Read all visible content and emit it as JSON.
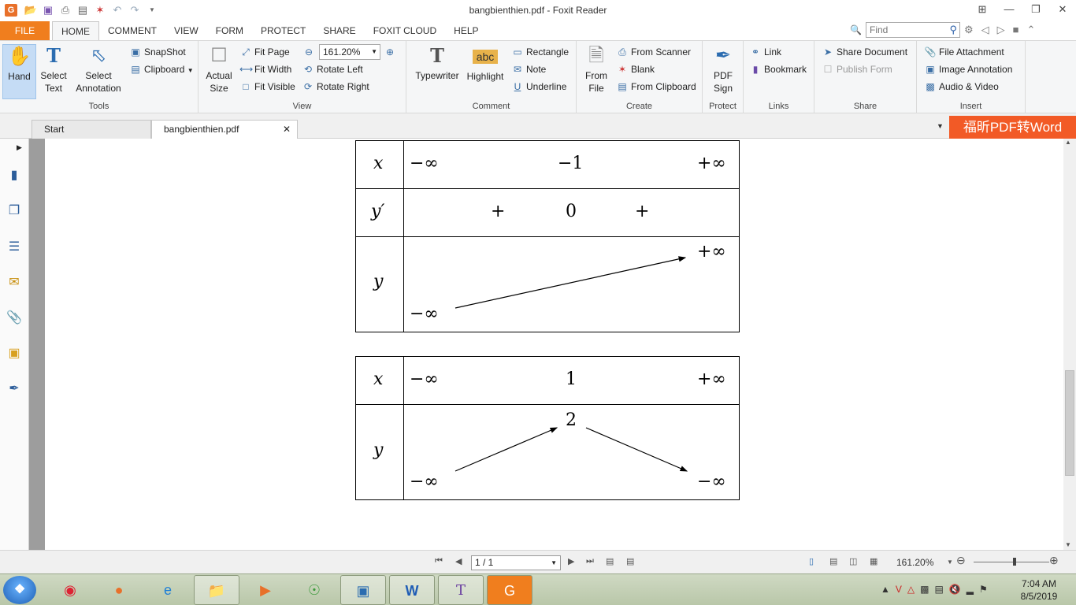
{
  "app": {
    "window_title": "bangbienthien.pdf - Foxit Reader"
  },
  "menu": {
    "file": "FILE",
    "tabs": [
      "HOME",
      "COMMENT",
      "VIEW",
      "FORM",
      "PROTECT",
      "SHARE",
      "FOXIT CLOUD",
      "HELP"
    ],
    "find_placeholder": "Find"
  },
  "ribbon": {
    "tools": {
      "label": "Tools",
      "hand": "Hand",
      "select_text_1": "Select",
      "select_text_2": "Text",
      "select_annotation_1": "Select",
      "select_annotation_2": "Annotation",
      "snapshot": "SnapShot",
      "clipboard": "Clipboard"
    },
    "view": {
      "label": "View",
      "actual_size_1": "Actual",
      "actual_size_2": "Size",
      "fit_page": "Fit Page",
      "fit_width": "Fit Width",
      "fit_visible": "Fit Visible",
      "zoom_value": "161.20%",
      "rotate_left": "Rotate Left",
      "rotate_right": "Rotate Right"
    },
    "comment": {
      "label": "Comment",
      "typewriter": "Typewriter",
      "highlight": "Highlight",
      "highlight_icon_text": "abc",
      "rectangle": "Rectangle",
      "note": "Note",
      "underline": "Underline"
    },
    "create": {
      "label": "Create",
      "from_file_1": "From",
      "from_file_2": "File",
      "from_scanner": "From Scanner",
      "blank": "Blank",
      "from_clipboard": "From Clipboard"
    },
    "protect": {
      "label": "Protect",
      "pdf_sign_1": "PDF",
      "pdf_sign_2": "Sign"
    },
    "links": {
      "label": "Links",
      "link": "Link",
      "bookmark": "Bookmark"
    },
    "share": {
      "label": "Share",
      "share_document": "Share Document",
      "publish_form": "Publish Form"
    },
    "insert": {
      "label": "Insert",
      "file_attachment": "File Attachment",
      "image_annotation": "Image Annotation",
      "audio_video": "Audio & Video"
    }
  },
  "doc_tabs": {
    "start": "Start",
    "active": "bangbienthien.pdf",
    "promo": "福昕PDF转Word"
  },
  "document": {
    "table1": {
      "x_label": "x",
      "x_values": [
        "−∞",
        "−1",
        "+∞"
      ],
      "yprime_label": "y′",
      "yprime_values": [
        "+",
        "0",
        "+"
      ],
      "y_label": "y",
      "y_values": [
        "+∞",
        "−∞"
      ]
    },
    "table2": {
      "x_label": "x",
      "x_values": [
        "−∞",
        "1",
        "+∞"
      ],
      "y_label": "y",
      "y_values": [
        "2",
        "−∞",
        "−∞"
      ]
    }
  },
  "status": {
    "page_value": "1 / 1",
    "zoom": "161.20%"
  },
  "taskbar": {
    "time": "7:04 AM",
    "date": "8/5/2019"
  }
}
